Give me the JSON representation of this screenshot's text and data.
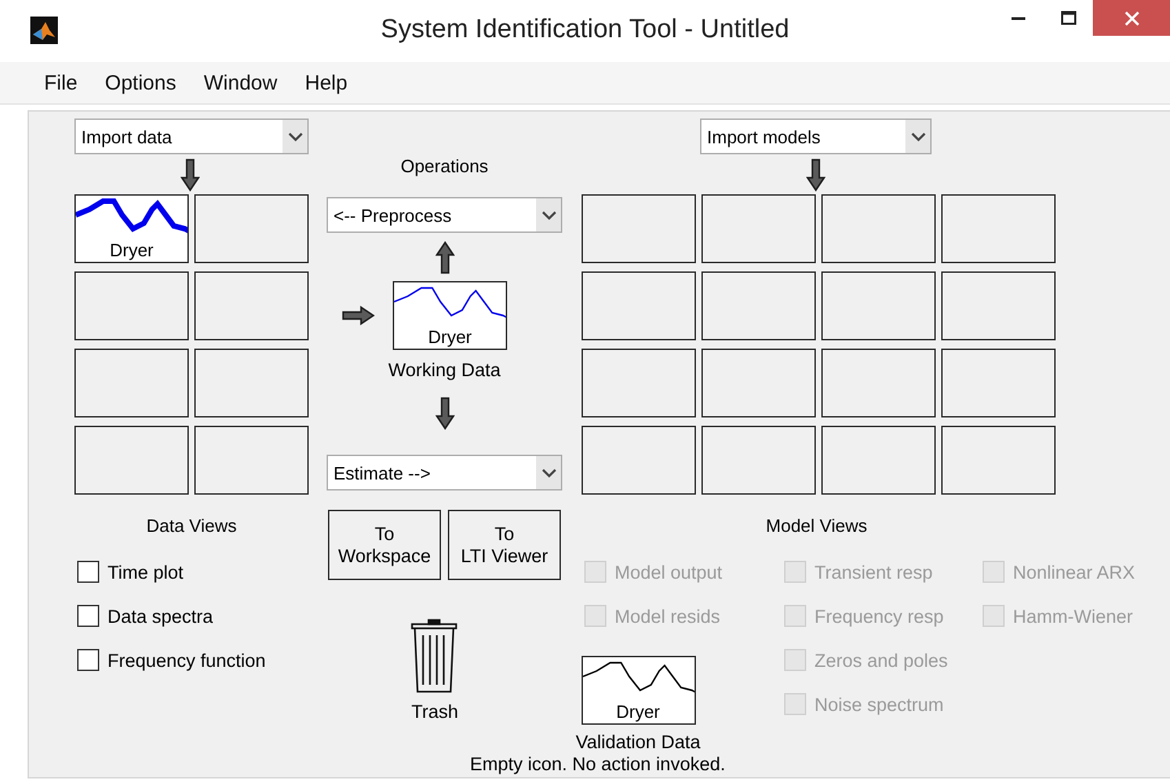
{
  "window": {
    "title": "System Identification Tool - Untitled"
  },
  "menu": [
    "File",
    "Options",
    "Window",
    "Help"
  ],
  "data_import": {
    "value": "Import data"
  },
  "data_board": {
    "tiles": [
      {
        "kind": "data",
        "label": "Dryer"
      },
      {
        "kind": "empty"
      },
      {
        "kind": "empty"
      },
      {
        "kind": "empty"
      },
      {
        "kind": "empty"
      },
      {
        "kind": "empty"
      },
      {
        "kind": "empty"
      },
      {
        "kind": "empty"
      }
    ]
  },
  "data_views": {
    "title": "Data Views",
    "options": [
      {
        "label": "Time plot",
        "checked": false,
        "disabled": false
      },
      {
        "label": "Data spectra",
        "checked": false,
        "disabled": false
      },
      {
        "label": "Frequency function",
        "checked": false,
        "disabled": false
      }
    ]
  },
  "operations": {
    "title": "Operations",
    "preprocess": "<-- Preprocess",
    "working_data": {
      "label": "Dryer",
      "caption": "Working Data"
    },
    "estimate": "Estimate -->"
  },
  "buttons": [
    {
      "lines": [
        "To",
        "Workspace"
      ]
    },
    {
      "lines": [
        "To",
        "LTI Viewer"
      ]
    }
  ],
  "trash": {
    "label": "Trash"
  },
  "model_import": {
    "value": "Import models"
  },
  "model_board": {
    "tiles": [
      {
        "kind": "empty"
      },
      {
        "kind": "empty"
      },
      {
        "kind": "empty"
      },
      {
        "kind": "empty"
      },
      {
        "kind": "empty"
      },
      {
        "kind": "empty"
      },
      {
        "kind": "empty"
      },
      {
        "kind": "empty"
      },
      {
        "kind": "empty"
      },
      {
        "kind": "empty"
      },
      {
        "kind": "empty"
      },
      {
        "kind": "empty"
      },
      {
        "kind": "empty"
      },
      {
        "kind": "empty"
      },
      {
        "kind": "empty"
      },
      {
        "kind": "empty"
      }
    ]
  },
  "model_views": {
    "title": "Model Views",
    "columns": [
      [
        {
          "label": "Model output",
          "checked": false,
          "disabled": true
        },
        {
          "label": "Model resids",
          "checked": false,
          "disabled": true
        }
      ],
      [
        {
          "label": "Transient resp",
          "checked": false,
          "disabled": true
        },
        {
          "label": "Frequency resp",
          "checked": false,
          "disabled": true
        },
        {
          "label": "Zeros and poles",
          "checked": false,
          "disabled": true
        },
        {
          "label": "Noise spectrum",
          "checked": false,
          "disabled": true
        }
      ],
      [
        {
          "label": "Nonlinear ARX",
          "checked": false,
          "disabled": true
        },
        {
          "label": "Hamm-Wiener",
          "checked": false,
          "disabled": true
        }
      ]
    ]
  },
  "validation_data": {
    "label": "Dryer",
    "caption": "Validation Data"
  },
  "status": "Empty icon. No action invoked."
}
